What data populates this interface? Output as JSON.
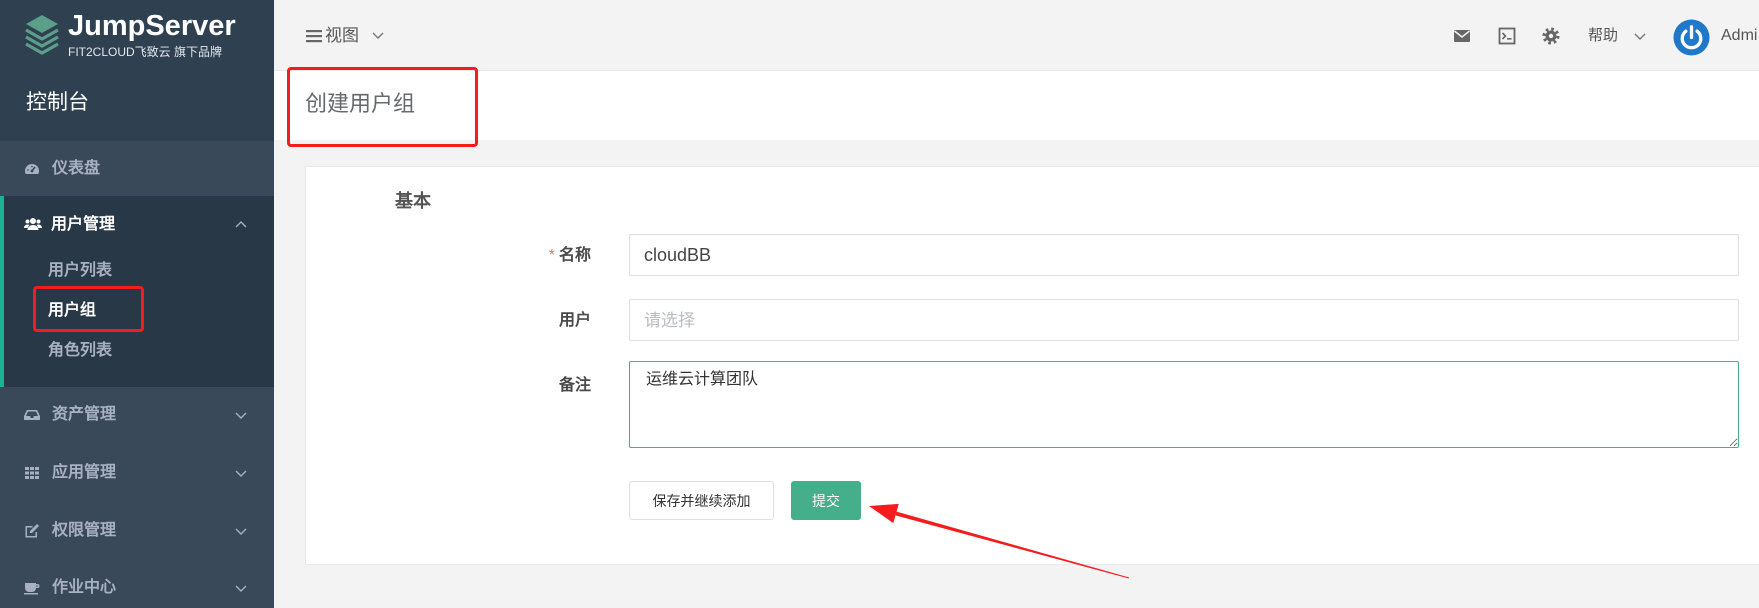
{
  "app": {
    "brand_name": "JumpServer",
    "brand_tagline": "FIT2CLOUD飞致云 旗下品牌",
    "logo_icon": "jumpserver-logo-icon"
  },
  "sidebar": {
    "console_label": "控制台",
    "items": [
      {
        "label": "仪表盘",
        "icon": "dashboard-icon"
      },
      {
        "label": "用户管理",
        "icon": "users-icon",
        "expanded": true,
        "children": [
          {
            "label": "用户列表"
          },
          {
            "label": "用户组",
            "active": true
          },
          {
            "label": "角色列表"
          }
        ]
      },
      {
        "label": "资产管理",
        "icon": "inbox-icon"
      },
      {
        "label": "应用管理",
        "icon": "grid-icon"
      },
      {
        "label": "权限管理",
        "icon": "edit-icon"
      },
      {
        "label": "作业中心",
        "icon": "coffee-icon"
      }
    ]
  },
  "topbar": {
    "view_label": "视图",
    "icons": [
      "mail-icon",
      "terminal-icon",
      "gear-icon"
    ],
    "help_label": "帮助",
    "user_name": "Admi"
  },
  "page": {
    "title": "创建用户组"
  },
  "form": {
    "section_title": "基本",
    "name": {
      "label": "名称",
      "required_mark": "*",
      "value": "cloudBB"
    },
    "users": {
      "label": "用户",
      "placeholder": "请选择"
    },
    "comment": {
      "label": "备注",
      "value": "运维云计算团队"
    },
    "save_continue_label": "保存并继续添加",
    "submit_label": "提交"
  },
  "colors": {
    "sidebar_bg": "#3a4959",
    "sidebar_header_bg": "#2f4050",
    "sidebar_active_bg": "#293846",
    "accent": "#1ab394",
    "primary_button": "#45ae8b",
    "annotation_red": "#f41c1c"
  }
}
